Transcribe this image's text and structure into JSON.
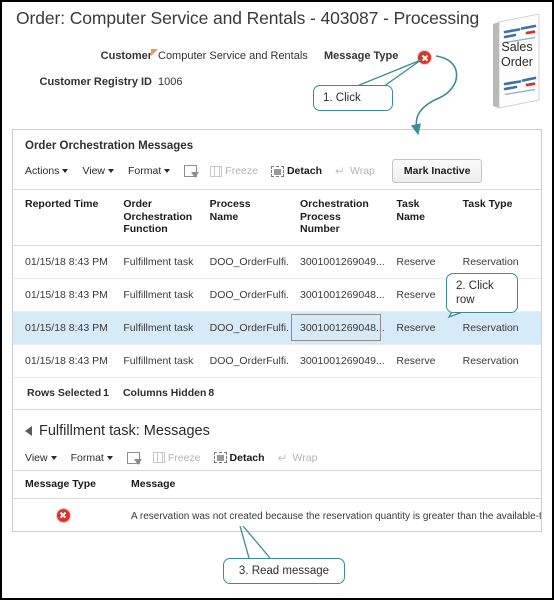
{
  "header": {
    "page_title": "Order: Computer Service and Rentals - 403087 - Processing",
    "customer_label": "Customer",
    "customer_value": "Computer Service and Rentals",
    "registry_label": "Customer Registry ID",
    "registry_value": "1006",
    "message_type_label": "Message Type",
    "message_type_icon": "error-x-icon",
    "sales_order_badge_line1": "Sales",
    "sales_order_badge_line2": "Order"
  },
  "callouts": {
    "step1": "1. Click",
    "step2": "2. Click row",
    "step3": "3. Read message"
  },
  "panel": {
    "title": "Order Orchestration Messages",
    "toolbar": {
      "actions": "Actions",
      "view": "View",
      "format": "Format",
      "detach_filter_icon": "detach-filter-icon",
      "freeze": "Freeze",
      "detach": "Detach",
      "wrap": "Wrap",
      "mark_inactive": "Mark Inactive"
    },
    "columns": [
      "Reported Time",
      "Order Orchestration Function",
      "Process Name",
      "Orchestration Process Number",
      "Task Name",
      "Task Type"
    ],
    "rows": [
      {
        "reported_time": "01/15/18 8:43 PM",
        "function": "Fulfillment task",
        "process_name": "DOO_OrderFulfi...",
        "process_number": "3001001269049...",
        "task_name": "Reserve",
        "task_type": "Reservation",
        "selected": false
      },
      {
        "reported_time": "01/15/18 8:43 PM",
        "function": "Fulfillment task",
        "process_name": "DOO_OrderFulfi...",
        "process_number": "3001001269048...",
        "task_name": "Reserve",
        "task_type": "Reservation",
        "selected": false
      },
      {
        "reported_time": "01/15/18 8:43 PM",
        "function": "Fulfillment task",
        "process_name": "DOO_OrderFulfi...",
        "process_number": "3001001269048...",
        "task_name": "Reserve",
        "task_type": "Reservation",
        "selected": true
      },
      {
        "reported_time": "01/15/18 8:43 PM",
        "function": "Fulfillment task",
        "process_name": "DOO_OrderFulfi...",
        "process_number": "3001001269049...",
        "task_name": "Reserve",
        "task_type": "Reservation",
        "selected": false
      }
    ],
    "status": {
      "rows_selected_label": "Rows Selected",
      "rows_selected_value": "1",
      "columns_hidden_label": "Columns Hidden",
      "columns_hidden_value": "8"
    }
  },
  "subsection": {
    "title": "Fulfillment task: Messages",
    "toolbar": {
      "view": "View",
      "format": "Format",
      "detach_filter_icon": "detach-filter-icon",
      "freeze": "Freeze",
      "detach": "Detach",
      "wrap": "Wrap"
    },
    "columns": [
      "Message Type",
      "Message"
    ],
    "rows": [
      {
        "message_type_icon": "error-x-icon",
        "message": "A reservation was not created because the reservation quantity is greater than the available-to-r"
      }
    ]
  },
  "colors": {
    "accent_callout": "#3d8b98",
    "error_red": "#d9352c",
    "selected_row": "#d6eaf7",
    "required_marker": "#f0954a"
  }
}
